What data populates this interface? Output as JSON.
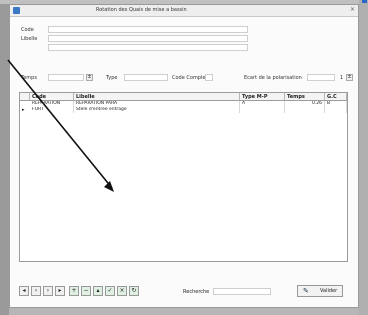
{
  "window": {
    "title": "Rotation des Quais de mise a bassin"
  },
  "form": {
    "code_label": "Code",
    "libelle_label": "Libelle",
    "temps_label": "Temps",
    "type_label": "Type",
    "code_complete_label": "Code Complete",
    "ecart_label": "Ecart de la polarisation",
    "ecart_value": "1"
  },
  "table": {
    "columns": [
      "Code",
      "Libelle",
      "Type M-P",
      "Temps",
      "G.C"
    ],
    "rows": [
      [
        "REPARATION",
        "REPARATION PARA",
        "A",
        "0.26",
        "B"
      ],
      [
        "FORT",
        "Stele d'entree entrage",
        "",
        "",
        ""
      ]
    ]
  },
  "toolbar": {
    "icons": [
      "first-icon",
      "prev-icon",
      "next-icon",
      "last-icon",
      "add-icon",
      "delete-icon",
      "edit-icon",
      "save-icon",
      "refresh-icon",
      "check-icon"
    ]
  },
  "search": {
    "label": "Recherche"
  },
  "validate": {
    "label": "Valider"
  }
}
